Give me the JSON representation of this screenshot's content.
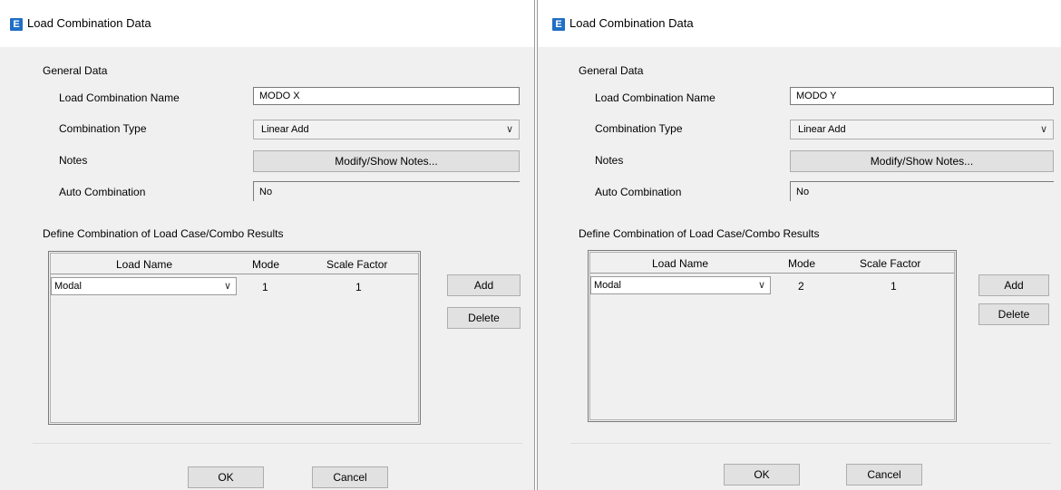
{
  "dialogs": [
    {
      "title": "Load Combination Data",
      "icon_letter": "E",
      "general_data_label": "General Data",
      "name_label": "Load Combination Name",
      "name_value": "MODO X",
      "type_label": "Combination Type",
      "type_value": "Linear Add",
      "notes_label": "Notes",
      "notes_button": "Modify/Show Notes...",
      "auto_label": "Auto Combination",
      "auto_value": "No",
      "define_label": "Define Combination of Load Case/Combo Results",
      "grid_headers": [
        "Load Name",
        "Mode",
        "Scale Factor"
      ],
      "row": {
        "load_name": "Modal",
        "mode": "1",
        "scale_factor": "1"
      },
      "add_button": "Add",
      "delete_button": "Delete",
      "ok_button": "OK",
      "cancel_button": "Cancel"
    },
    {
      "title": "Load Combination Data",
      "icon_letter": "E",
      "general_data_label": "General Data",
      "name_label": "Load Combination Name",
      "name_value": "MODO Y",
      "type_label": "Combination Type",
      "type_value": "Linear Add",
      "notes_label": "Notes",
      "notes_button": "Modify/Show Notes...",
      "auto_label": "Auto Combination",
      "auto_value": "No",
      "define_label": "Define Combination of Load Case/Combo Results",
      "grid_headers": [
        "Load Name",
        "Mode",
        "Scale Factor"
      ],
      "row": {
        "load_name": "Modal",
        "mode": "2",
        "scale_factor": "1"
      },
      "add_button": "Add",
      "delete_button": "Delete",
      "ok_button": "OK",
      "cancel_button": "Cancel"
    }
  ],
  "icons": {
    "chevron": "chevron-down-icon",
    "app": "etabs-app-icon"
  },
  "colors": {
    "app_icon": "#1f6fc5",
    "dialog_bg": "#f0f0f0",
    "button_bg": "#e1e1e1"
  }
}
